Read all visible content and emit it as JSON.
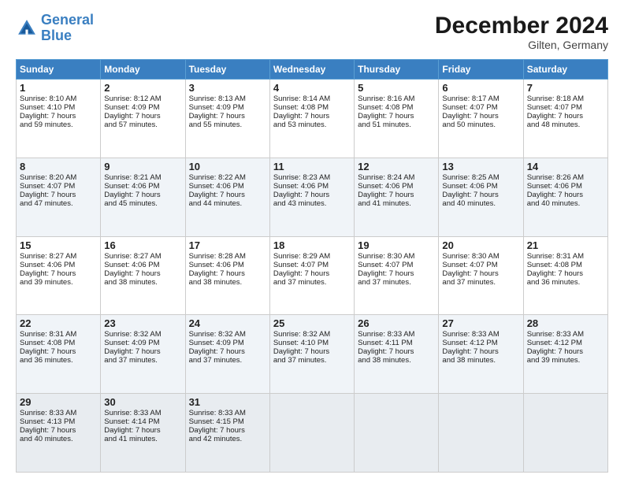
{
  "header": {
    "logo_line1": "General",
    "logo_line2": "Blue",
    "month_title": "December 2024",
    "location": "Gilten, Germany"
  },
  "days_of_week": [
    "Sunday",
    "Monday",
    "Tuesday",
    "Wednesday",
    "Thursday",
    "Friday",
    "Saturday"
  ],
  "weeks": [
    [
      {
        "day": "1",
        "lines": [
          "Sunrise: 8:10 AM",
          "Sunset: 4:10 PM",
          "Daylight: 7 hours",
          "and 59 minutes."
        ]
      },
      {
        "day": "2",
        "lines": [
          "Sunrise: 8:12 AM",
          "Sunset: 4:09 PM",
          "Daylight: 7 hours",
          "and 57 minutes."
        ]
      },
      {
        "day": "3",
        "lines": [
          "Sunrise: 8:13 AM",
          "Sunset: 4:09 PM",
          "Daylight: 7 hours",
          "and 55 minutes."
        ]
      },
      {
        "day": "4",
        "lines": [
          "Sunrise: 8:14 AM",
          "Sunset: 4:08 PM",
          "Daylight: 7 hours",
          "and 53 minutes."
        ]
      },
      {
        "day": "5",
        "lines": [
          "Sunrise: 8:16 AM",
          "Sunset: 4:08 PM",
          "Daylight: 7 hours",
          "and 51 minutes."
        ]
      },
      {
        "day": "6",
        "lines": [
          "Sunrise: 8:17 AM",
          "Sunset: 4:07 PM",
          "Daylight: 7 hours",
          "and 50 minutes."
        ]
      },
      {
        "day": "7",
        "lines": [
          "Sunrise: 8:18 AM",
          "Sunset: 4:07 PM",
          "Daylight: 7 hours",
          "and 48 minutes."
        ]
      }
    ],
    [
      {
        "day": "8",
        "lines": [
          "Sunrise: 8:20 AM",
          "Sunset: 4:07 PM",
          "Daylight: 7 hours",
          "and 47 minutes."
        ]
      },
      {
        "day": "9",
        "lines": [
          "Sunrise: 8:21 AM",
          "Sunset: 4:06 PM",
          "Daylight: 7 hours",
          "and 45 minutes."
        ]
      },
      {
        "day": "10",
        "lines": [
          "Sunrise: 8:22 AM",
          "Sunset: 4:06 PM",
          "Daylight: 7 hours",
          "and 44 minutes."
        ]
      },
      {
        "day": "11",
        "lines": [
          "Sunrise: 8:23 AM",
          "Sunset: 4:06 PM",
          "Daylight: 7 hours",
          "and 43 minutes."
        ]
      },
      {
        "day": "12",
        "lines": [
          "Sunrise: 8:24 AM",
          "Sunset: 4:06 PM",
          "Daylight: 7 hours",
          "and 41 minutes."
        ]
      },
      {
        "day": "13",
        "lines": [
          "Sunrise: 8:25 AM",
          "Sunset: 4:06 PM",
          "Daylight: 7 hours",
          "and 40 minutes."
        ]
      },
      {
        "day": "14",
        "lines": [
          "Sunrise: 8:26 AM",
          "Sunset: 4:06 PM",
          "Daylight: 7 hours",
          "and 40 minutes."
        ]
      }
    ],
    [
      {
        "day": "15",
        "lines": [
          "Sunrise: 8:27 AM",
          "Sunset: 4:06 PM",
          "Daylight: 7 hours",
          "and 39 minutes."
        ]
      },
      {
        "day": "16",
        "lines": [
          "Sunrise: 8:27 AM",
          "Sunset: 4:06 PM",
          "Daylight: 7 hours",
          "and 38 minutes."
        ]
      },
      {
        "day": "17",
        "lines": [
          "Sunrise: 8:28 AM",
          "Sunset: 4:06 PM",
          "Daylight: 7 hours",
          "and 38 minutes."
        ]
      },
      {
        "day": "18",
        "lines": [
          "Sunrise: 8:29 AM",
          "Sunset: 4:07 PM",
          "Daylight: 7 hours",
          "and 37 minutes."
        ]
      },
      {
        "day": "19",
        "lines": [
          "Sunrise: 8:30 AM",
          "Sunset: 4:07 PM",
          "Daylight: 7 hours",
          "and 37 minutes."
        ]
      },
      {
        "day": "20",
        "lines": [
          "Sunrise: 8:30 AM",
          "Sunset: 4:07 PM",
          "Daylight: 7 hours",
          "and 37 minutes."
        ]
      },
      {
        "day": "21",
        "lines": [
          "Sunrise: 8:31 AM",
          "Sunset: 4:08 PM",
          "Daylight: 7 hours",
          "and 36 minutes."
        ]
      }
    ],
    [
      {
        "day": "22",
        "lines": [
          "Sunrise: 8:31 AM",
          "Sunset: 4:08 PM",
          "Daylight: 7 hours",
          "and 36 minutes."
        ]
      },
      {
        "day": "23",
        "lines": [
          "Sunrise: 8:32 AM",
          "Sunset: 4:09 PM",
          "Daylight: 7 hours",
          "and 37 minutes."
        ]
      },
      {
        "day": "24",
        "lines": [
          "Sunrise: 8:32 AM",
          "Sunset: 4:09 PM",
          "Daylight: 7 hours",
          "and 37 minutes."
        ]
      },
      {
        "day": "25",
        "lines": [
          "Sunrise: 8:32 AM",
          "Sunset: 4:10 PM",
          "Daylight: 7 hours",
          "and 37 minutes."
        ]
      },
      {
        "day": "26",
        "lines": [
          "Sunrise: 8:33 AM",
          "Sunset: 4:11 PM",
          "Daylight: 7 hours",
          "and 38 minutes."
        ]
      },
      {
        "day": "27",
        "lines": [
          "Sunrise: 8:33 AM",
          "Sunset: 4:12 PM",
          "Daylight: 7 hours",
          "and 38 minutes."
        ]
      },
      {
        "day": "28",
        "lines": [
          "Sunrise: 8:33 AM",
          "Sunset: 4:12 PM",
          "Daylight: 7 hours",
          "and 39 minutes."
        ]
      }
    ],
    [
      {
        "day": "29",
        "lines": [
          "Sunrise: 8:33 AM",
          "Sunset: 4:13 PM",
          "Daylight: 7 hours",
          "and 40 minutes."
        ]
      },
      {
        "day": "30",
        "lines": [
          "Sunrise: 8:33 AM",
          "Sunset: 4:14 PM",
          "Daylight: 7 hours",
          "and 41 minutes."
        ]
      },
      {
        "day": "31",
        "lines": [
          "Sunrise: 8:33 AM",
          "Sunset: 4:15 PM",
          "Daylight: 7 hours",
          "and 42 minutes."
        ]
      },
      null,
      null,
      null,
      null
    ]
  ]
}
